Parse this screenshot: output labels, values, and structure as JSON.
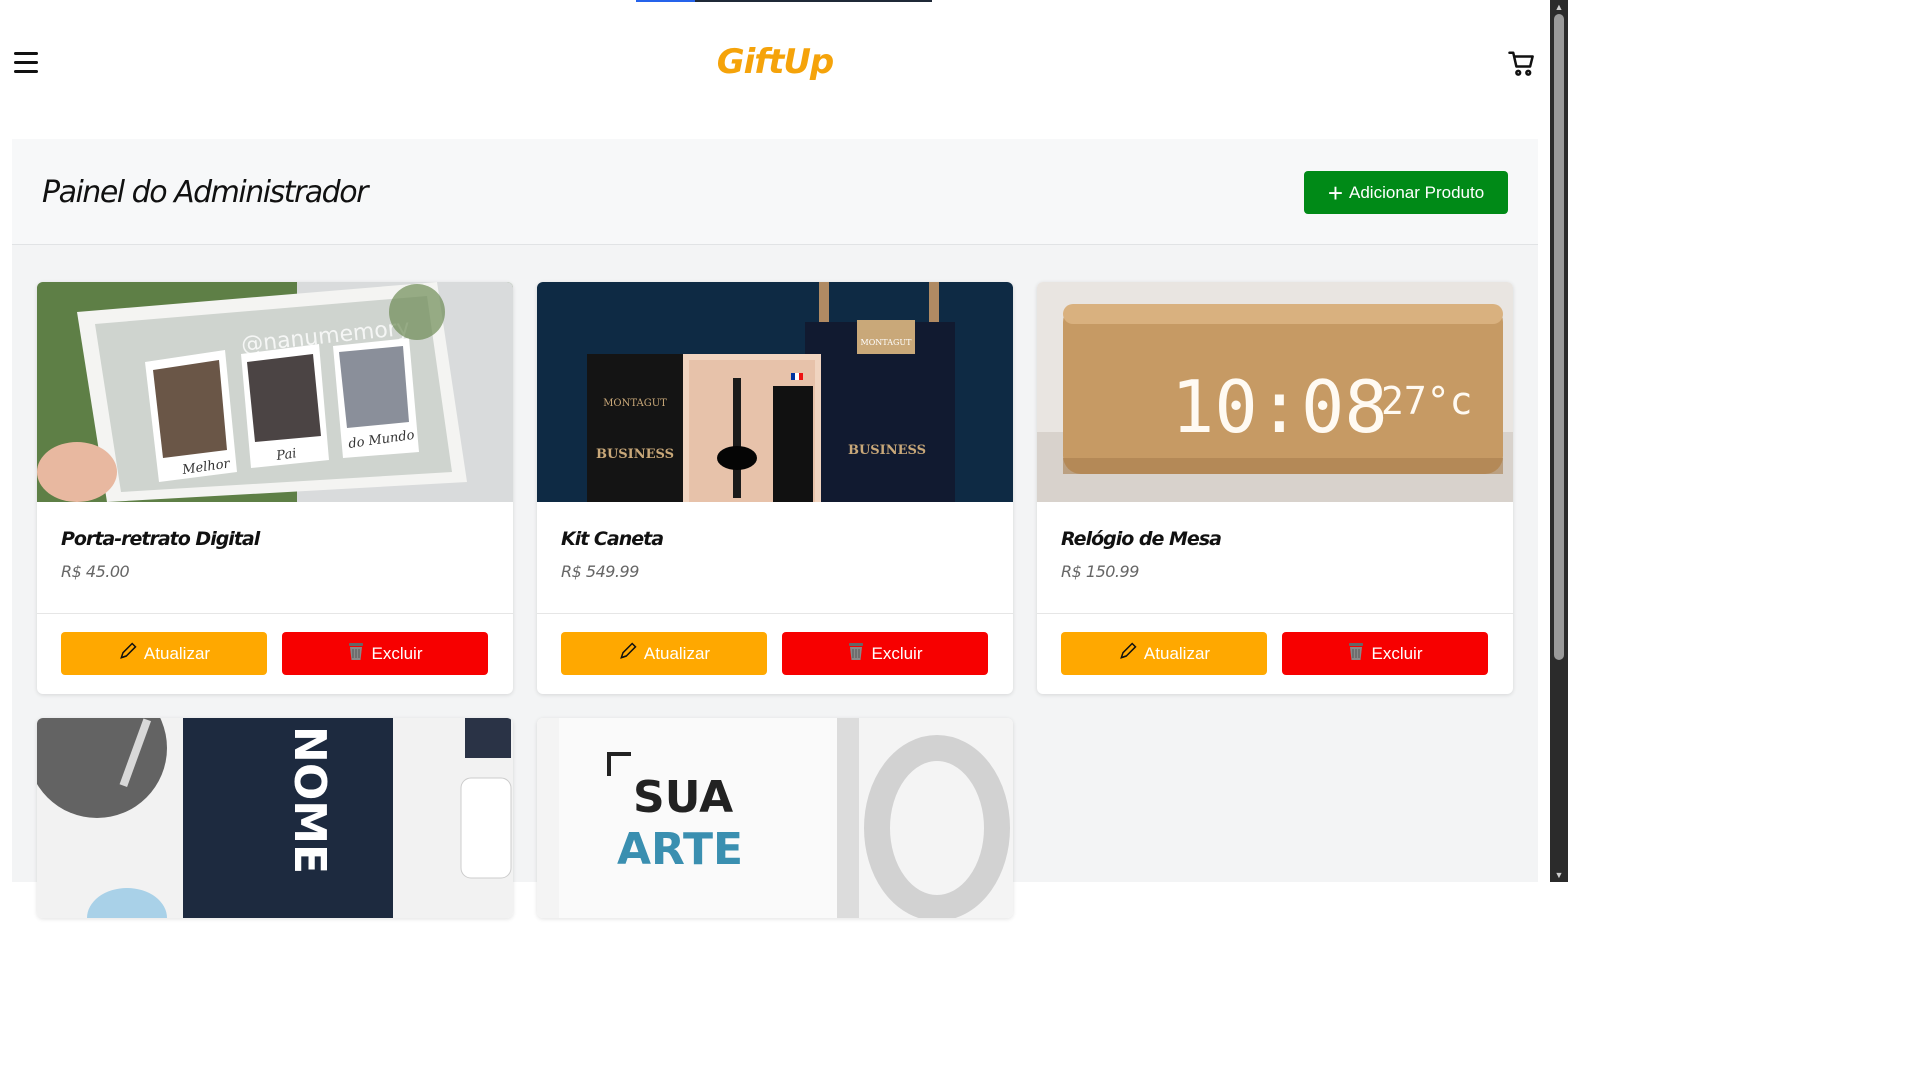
{
  "app": {
    "logo": "GiftUp",
    "loading_progress": 0.2
  },
  "header": {
    "menu_icon": "hamburger-menu-icon",
    "cart_icon": "shopping-cart-icon"
  },
  "panel": {
    "title": "Painel do Administrador",
    "add_button_label": "Adicionar Produto"
  },
  "colors": {
    "brand": "#f5a30a",
    "add_button": "#008a17",
    "update_button": "#ffa800",
    "delete_button": "#f70000"
  },
  "products": [
    {
      "name": "Porta-retrato Digital",
      "price": "R$ 45.00",
      "image_text": [
        "@nanumemory",
        "Melhor",
        "Pai",
        "do Mundo"
      ],
      "update_label": "Atualizar",
      "delete_label": "Excluir"
    },
    {
      "name": "Kit Caneta",
      "price": "R$ 549.99",
      "image_text": [
        "MONTAGUT",
        "BUSINESS",
        "MONTAGUT",
        "BUSINESS"
      ],
      "update_label": "Atualizar",
      "delete_label": "Excluir"
    },
    {
      "name": "Relógio de Mesa",
      "price": "R$ 150.99",
      "image_text": [
        "10:08",
        "27°c"
      ],
      "update_label": "Atualizar",
      "delete_label": "Excluir"
    },
    {
      "image_text": [
        "NOME"
      ]
    },
    {
      "image_text": [
        "SUA",
        "ARTE"
      ]
    }
  ]
}
